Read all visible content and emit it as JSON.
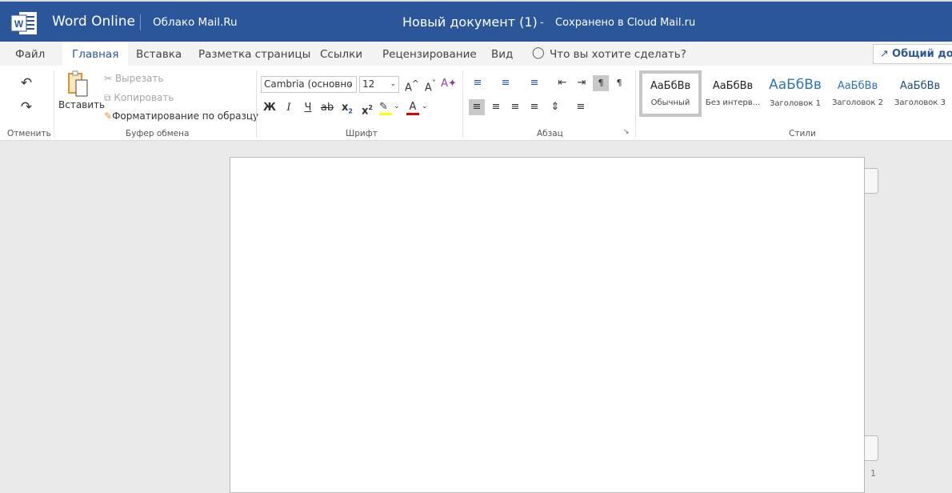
{
  "header": {
    "app": "Word Online",
    "service": "Облако Mail.Ru",
    "doc_title": "Новый документ (1)",
    "separator": "-",
    "status": "Сохранено в Cloud Mail.ru",
    "color": "#2b579a"
  },
  "tabs": [
    "Файл",
    "Главная",
    "Вставка",
    "Разметка страницы",
    "Ссылки",
    "Рецензирование",
    "Вид"
  ],
  "active_tab": "Главная",
  "tell_me": "Что вы хотите сделать?",
  "share": "Общий дос",
  "ribbon": {
    "undo": {
      "label": "Отменить"
    },
    "clipboard": {
      "paste": "Вставить",
      "cut": "Вырезать",
      "copy": "Копировать",
      "format_painter": "Форматирование по образцу",
      "label": "Буфер обмена"
    },
    "font": {
      "name": "Cambria (основно",
      "size": "12",
      "bold": "Ж",
      "italic": "I",
      "underline": "Ч",
      "strike": "ab",
      "sub": "x",
      "sup": "x",
      "color_letter": "A",
      "grow": "A",
      "shrink": "A",
      "label": "Шрифт",
      "highlight_color": "#ffff00",
      "font_color": "#e00000"
    },
    "paragraph": {
      "label": "Абзац"
    },
    "styles": {
      "label": "Стили",
      "items": [
        {
          "preview": "АаБбВв",
          "name": "Обычный"
        },
        {
          "preview": "АаБбВв",
          "name": "Без интерв..."
        },
        {
          "preview": "АаБбВв",
          "name": "Заголовок 1"
        },
        {
          "preview": "АаБбВв",
          "name": "Заголовок 2"
        },
        {
          "preview": "АаБбВв",
          "name": "Заголовок 3"
        }
      ]
    }
  },
  "page_number": "1"
}
